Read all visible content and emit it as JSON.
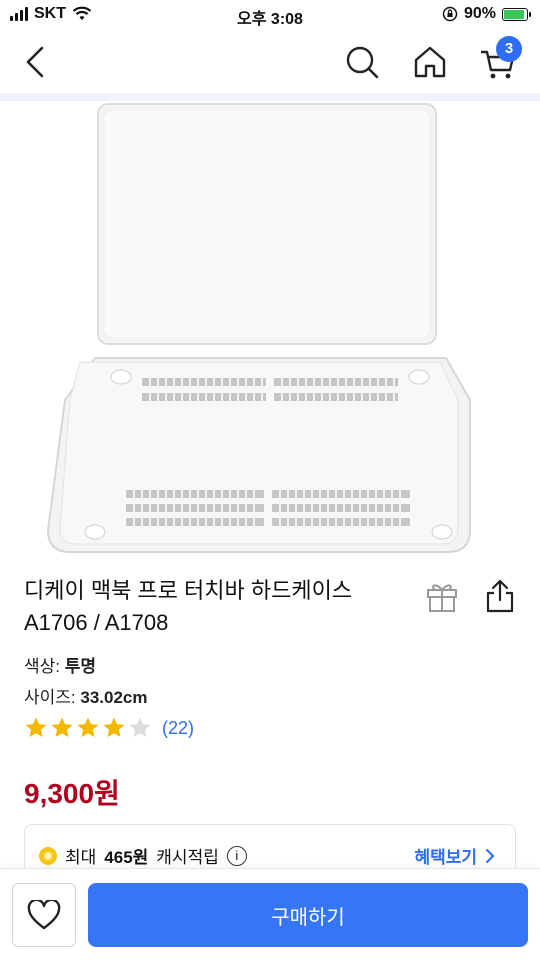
{
  "status_bar": {
    "carrier": "SKT",
    "time": "오후 3:08",
    "battery": "90%"
  },
  "navbar": {
    "cart_count": "3"
  },
  "product": {
    "title_line1": "디케이 맥북 프로 터치바 하드케이스",
    "title_line2": "A1706 / A1708",
    "color_label": "색상:",
    "color_value": "투명",
    "size_label": "사이즈:",
    "size_value": "33.02cm",
    "rating": 4,
    "rating_max": 5,
    "review_count": "(22)",
    "price": "9,300원"
  },
  "benefit": {
    "prefix": "최대",
    "amount": "465원",
    "suffix": "캐시적립",
    "info_glyph": "i",
    "link_label": "혜택보기"
  },
  "bottom": {
    "buy_label": "구매하기"
  },
  "colors": {
    "accent": "#3476f7",
    "price": "#b00020",
    "star": "#f5b800",
    "star_empty": "#dcdcdc"
  }
}
